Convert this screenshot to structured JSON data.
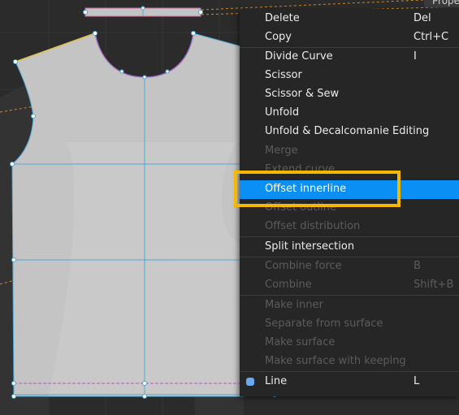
{
  "corner_tab": {
    "label": "Prope"
  },
  "menu": {
    "items": [
      {
        "label": "Delete",
        "shortcut": "Del",
        "enabled": true
      },
      {
        "label": "Copy",
        "shortcut": "Ctrl+C",
        "enabled": true
      },
      {
        "label": "Divide Curve",
        "shortcut": "I",
        "enabled": true
      },
      {
        "label": "Scissor",
        "shortcut": "",
        "enabled": true
      },
      {
        "label": "Scissor & Sew",
        "shortcut": "",
        "enabled": true
      },
      {
        "label": "Unfold",
        "shortcut": "",
        "enabled": true
      },
      {
        "label": "Unfold & Decalcomanie Editing",
        "shortcut": "",
        "enabled": true
      },
      {
        "label": "Merge",
        "shortcut": "",
        "enabled": false
      },
      {
        "label": "Extend curve",
        "shortcut": "",
        "enabled": false
      },
      {
        "label": "Offset innerline",
        "shortcut": "",
        "enabled": true,
        "selected": true
      },
      {
        "label": "Offset outline",
        "shortcut": "",
        "enabled": false
      },
      {
        "label": "Offset distribution",
        "shortcut": "",
        "enabled": false
      },
      {
        "label": "Split intersection",
        "shortcut": "",
        "enabled": true
      },
      {
        "label": "Combine force",
        "shortcut": "B",
        "enabled": false
      },
      {
        "label": "Combine",
        "shortcut": "Shift+B",
        "enabled": false
      },
      {
        "label": "Make inner",
        "shortcut": "",
        "enabled": false
      },
      {
        "label": "Separate from surface",
        "shortcut": "",
        "enabled": false
      },
      {
        "label": "Make surface",
        "shortcut": "",
        "enabled": false
      },
      {
        "label": "Make surface with keeping",
        "shortcut": "",
        "enabled": false
      },
      {
        "label": "Line",
        "shortcut": "L",
        "enabled": true
      }
    ]
  },
  "colors": {
    "viewport_bg": "#2b2b2b",
    "pattern_fill": "#c4c4c4",
    "menu_bg": "#262626",
    "selected_bg": "#0a90f5",
    "callout_border": "#f5b800",
    "guide_line": "#4fa8d8",
    "seam_line": "#b05bb8"
  }
}
